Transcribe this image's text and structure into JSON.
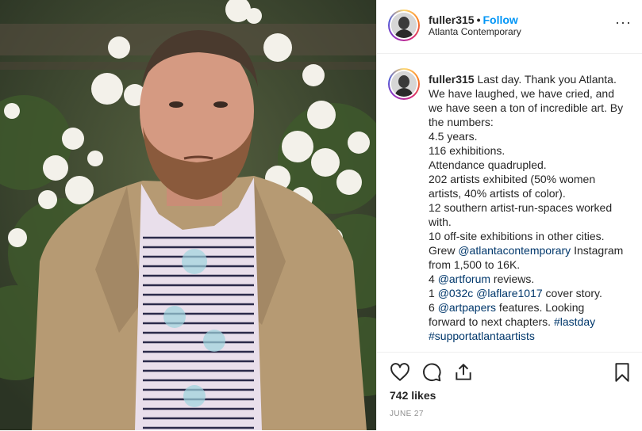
{
  "post": {
    "username": "fuller315",
    "separator": "•",
    "follow_label": "Follow",
    "location": "Atlanta Contemporary",
    "more_icon": "more-options-icon",
    "more_glyph": "···"
  },
  "caption": {
    "username": "fuller315",
    "lines": [
      [
        {
          "t": "Last day. Thank you Atlanta."
        }
      ],
      [
        {
          "t": "We have laughed, we have cried, and"
        }
      ],
      [
        {
          "t": "we have seen a ton of incredible art. By"
        }
      ],
      [
        {
          "t": "the numbers:"
        }
      ],
      [
        {
          "t": "4.5 years."
        }
      ],
      [
        {
          "t": "116 exhibitions."
        }
      ],
      [
        {
          "t": "Attendance quadrupled."
        }
      ],
      [
        {
          "t": "202 artists exhibited (50% women"
        }
      ],
      [
        {
          "t": "artists, 40% artists of color)."
        }
      ],
      [
        {
          "t": "12 southern artist-run-spaces worked"
        }
      ],
      [
        {
          "t": "with."
        }
      ],
      [
        {
          "t": "10 off-site exhibitions in other cities."
        }
      ],
      [
        {
          "t": "Grew "
        },
        {
          "t": "@atlantacontemporary",
          "m": true
        },
        {
          "t": " Instagram"
        }
      ],
      [
        {
          "t": "from 1,500 to 16K."
        }
      ],
      [
        {
          "t": "4 "
        },
        {
          "t": "@artforum",
          "m": true
        },
        {
          "t": " reviews."
        }
      ],
      [
        {
          "t": "1 "
        },
        {
          "t": "@032c",
          "m": true
        },
        {
          "t": " "
        },
        {
          "t": "@laflare1017",
          "m": true
        },
        {
          "t": " cover story."
        }
      ],
      [
        {
          "t": "6 "
        },
        {
          "t": "@artpapers",
          "m": true
        },
        {
          "t": " features. Looking"
        }
      ],
      [
        {
          "t": "forward to next chapters. "
        },
        {
          "t": "#lastday",
          "m": true
        }
      ],
      [
        {
          "t": "#supportatlantaartists",
          "m": true
        }
      ]
    ]
  },
  "actions": {
    "icons": [
      "heart-icon",
      "comment-icon",
      "share-icon",
      "bookmark-icon"
    ]
  },
  "likes": "742 likes",
  "date": "JUNE 27",
  "colors": {
    "follow": "#0095f6",
    "mention": "#00376b",
    "text": "#262626",
    "muted": "#8e8e8e",
    "border": "#efefef"
  }
}
